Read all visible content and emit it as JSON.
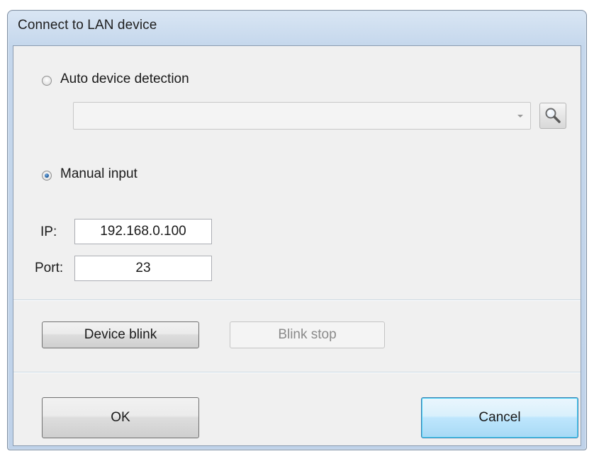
{
  "window": {
    "title": "Connect to LAN device"
  },
  "auto_detection": {
    "label": "Auto device detection",
    "selected": false,
    "device_combo_value": "",
    "search_icon": "magnifier-icon"
  },
  "manual_input": {
    "label": "Manual input",
    "selected": true,
    "ip_label": "IP:",
    "ip_value": "192.168.0.100",
    "port_label": "Port:",
    "port_value": "23"
  },
  "blink": {
    "device_blink_label": "Device blink",
    "blink_stop_label": "Blink stop"
  },
  "footer": {
    "ok_label": "OK",
    "cancel_label": "Cancel"
  },
  "colors": {
    "frame": "#bfd2e9",
    "client": "#f0f0f0",
    "focus_accent": "#3c7fb1",
    "radio_dot": "#1f5d9e"
  }
}
